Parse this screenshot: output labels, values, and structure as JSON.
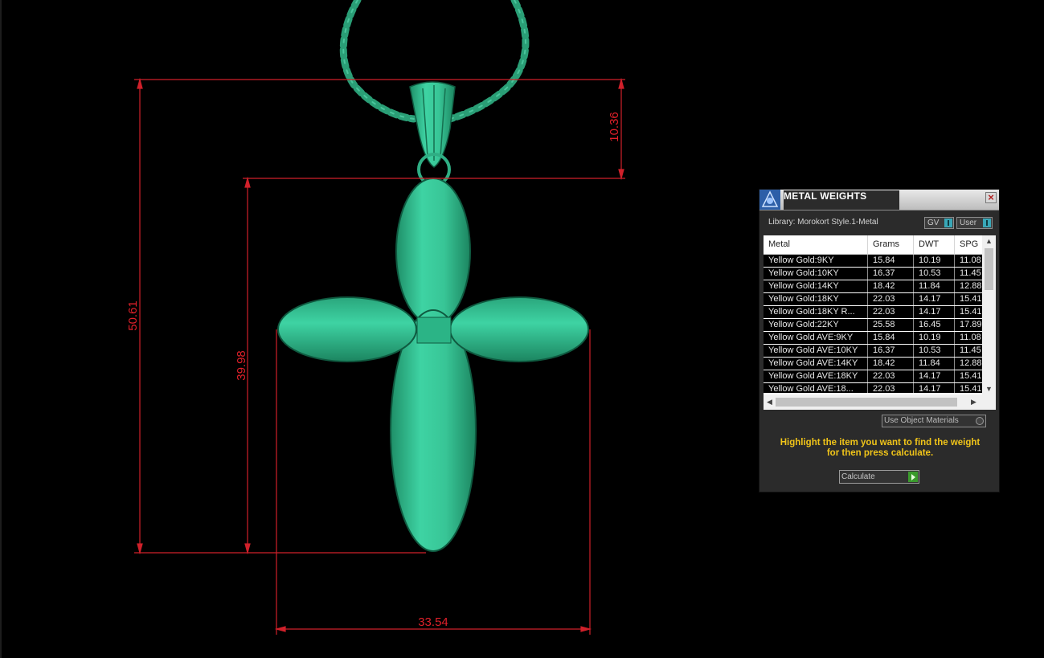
{
  "dimensions": {
    "total_height": "50.61",
    "body_height": "39.98",
    "bail_height": "10.36",
    "width": "33.54"
  },
  "panel": {
    "title": "METAL WEIGHTS",
    "close_icon": "close-icon",
    "library_label": "Library: Morokort Style.1-Metal",
    "toggle_gv": "GV",
    "toggle_user": "User",
    "columns": [
      "Metal",
      "Grams",
      "DWT",
      "SPG"
    ],
    "rows": [
      [
        "Yellow Gold:9KY",
        "15.84",
        "10.19",
        "11.08"
      ],
      [
        "Yellow Gold:10KY",
        "16.37",
        "10.53",
        "11.45"
      ],
      [
        "Yellow Gold:14KY",
        "18.42",
        "11.84",
        "12.88"
      ],
      [
        "Yellow Gold:18KY",
        "22.03",
        "14.17",
        "15.41"
      ],
      [
        "Yellow Gold:18KY R...",
        "22.03",
        "14.17",
        "15.41"
      ],
      [
        "Yellow Gold:22KY",
        "25.58",
        "16.45",
        "17.89"
      ],
      [
        "Yellow Gold AVE:9KY",
        "15.84",
        "10.19",
        "11.08"
      ],
      [
        "Yellow Gold AVE:10KY",
        "16.37",
        "10.53",
        "11.45"
      ],
      [
        "Yellow Gold AVE:14KY",
        "18.42",
        "11.84",
        "12.88"
      ],
      [
        "Yellow Gold AVE:18KY",
        "22.03",
        "14.17",
        "15.41"
      ],
      [
        "Yellow Gold AVE:18...",
        "22.03",
        "14.17",
        "15.41"
      ]
    ],
    "use_object_materials": "Use Object Materials",
    "hint_line1": "Highlight the item you want to find the weight",
    "hint_line2": "for then press calculate.",
    "calculate_label": "Calculate"
  },
  "colors": {
    "background": "#000000",
    "model": "#2fbf8f",
    "dimension": "#e0202a",
    "hint": "#f0c419"
  }
}
